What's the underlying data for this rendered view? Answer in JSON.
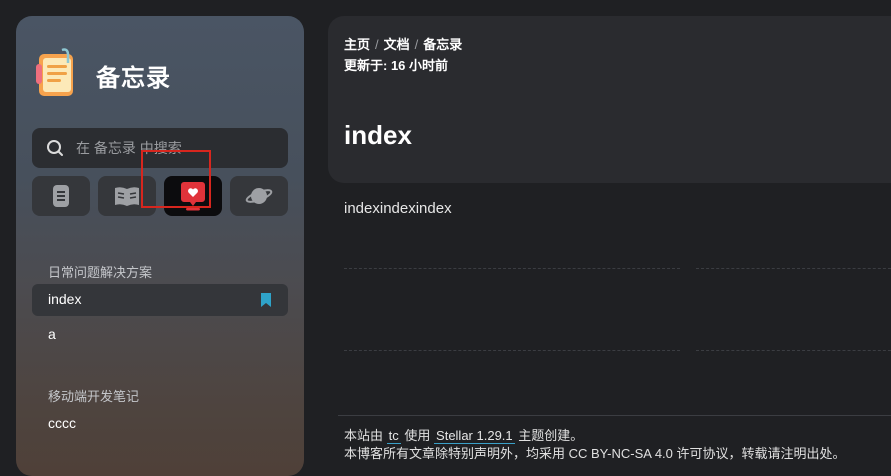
{
  "sidebar": {
    "app_title": "备忘录",
    "search_placeholder": "在 备忘录 中搜索",
    "tabs": [
      {
        "icon": "document-icon"
      },
      {
        "icon": "book-icon"
      },
      {
        "icon": "heart-message-icon",
        "active": true
      },
      {
        "icon": "planet-icon"
      }
    ],
    "sections": [
      {
        "title": "日常问题解决方案",
        "items": [
          {
            "label": "index",
            "selected": true
          },
          {
            "label": "a"
          }
        ]
      },
      {
        "title": "移动端开发笔记",
        "items": [
          {
            "label": "cccc"
          }
        ]
      }
    ]
  },
  "header": {
    "breadcrumb": [
      "主页",
      "文档",
      "备忘录"
    ],
    "updated": "更新于: 16 小时前",
    "title": "index"
  },
  "content": {
    "text": "indexindexindex"
  },
  "footer": {
    "prefix": "本站由",
    "link1": "tc",
    "middle": "使用",
    "link2": "Stellar 1.29.1",
    "suffix": "主题创建。",
    "line2": "本博客所有文章除特别声明外，均采用 CC BY-NC-SA 4.0 许可协议，转载请注明出处。"
  },
  "colors": {
    "accent": "#e0333a",
    "bookmark": "#2fa3c9",
    "highlight_box": "#d7261e"
  }
}
